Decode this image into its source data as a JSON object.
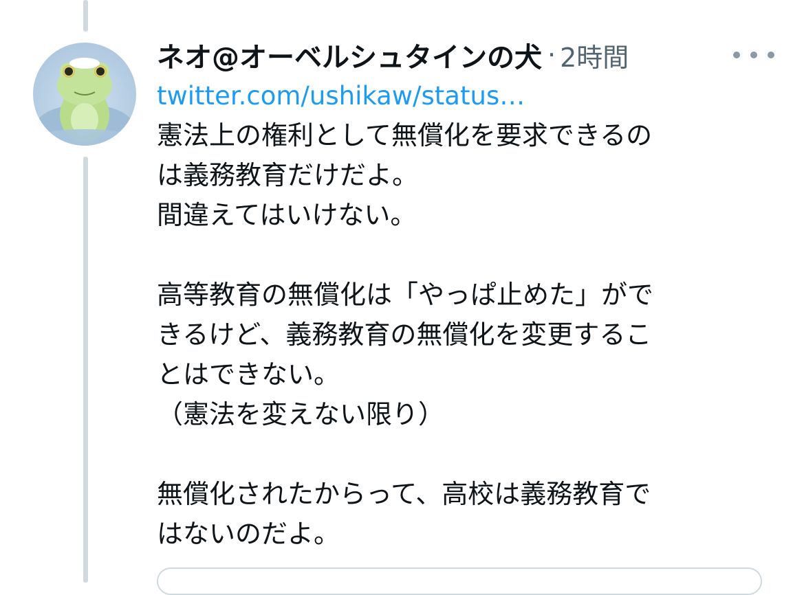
{
  "tweet": {
    "display_name": "ネオ@オーベルシュタインの犬",
    "separator": "·",
    "time": "2時間",
    "link_text": "twitter.com/ushikaw/status…",
    "paragraphs": [
      "憲法上の権利として無償化を要求できるの\nは義務教育だけだよ。\n間違えてはいけない。",
      "高等教育の無償化は「やっぱ止めた」がで\nきるけど、義務教育の無償化を変更するこ\nとはできない。\n（憲法を変えない限り）",
      "無償化されたからって、高校は義務教育で\nはないのだよ。"
    ]
  },
  "icons": {
    "more": "more-horizontal-icon",
    "avatar": "frog-avatar-image"
  },
  "colors": {
    "text": "#0f1419",
    "secondary": "#536471",
    "link": "#1d9bf0",
    "thread_line": "#cfd9de"
  }
}
